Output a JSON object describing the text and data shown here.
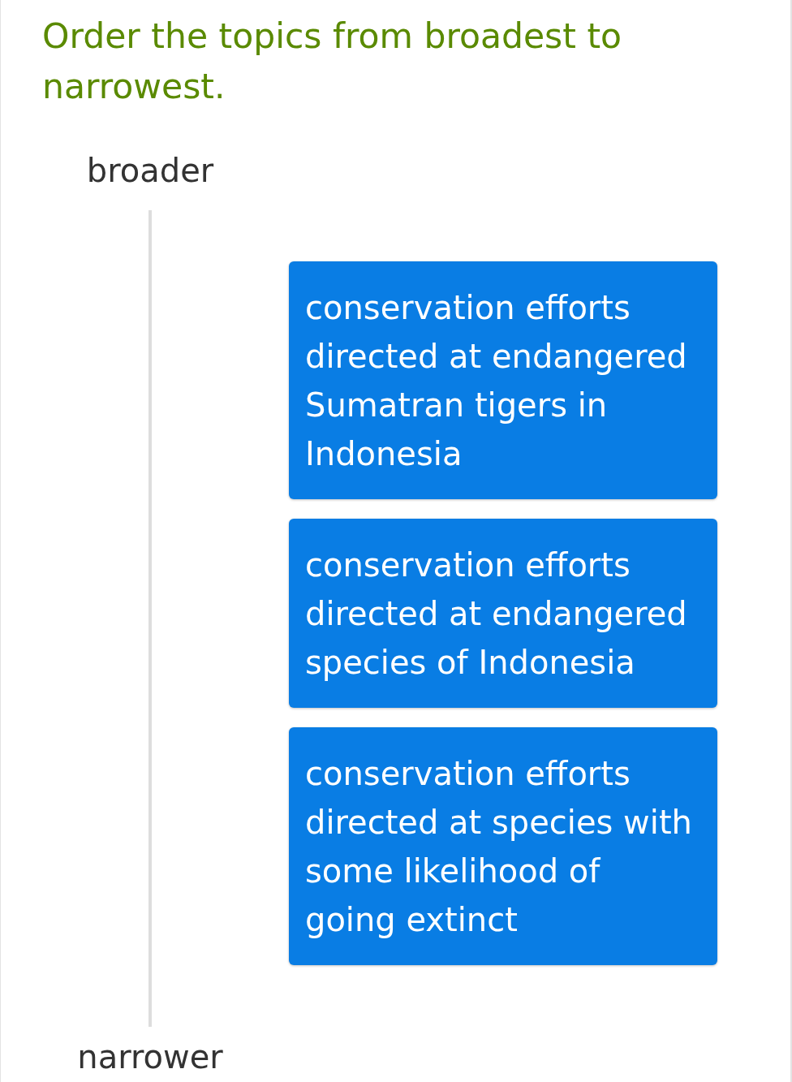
{
  "prompt": "Order the topics from broadest to narrowest.",
  "scale": {
    "top_label": "broader",
    "bottom_label": "narrower"
  },
  "items": [
    {
      "text": "conservation efforts directed at endangered Sumatran tigers in Indonesia"
    },
    {
      "text": "conservation efforts directed at endangered species of Indonesia"
    },
    {
      "text": "conservation efforts directed at species with some likelihood of going extinct"
    }
  ]
}
